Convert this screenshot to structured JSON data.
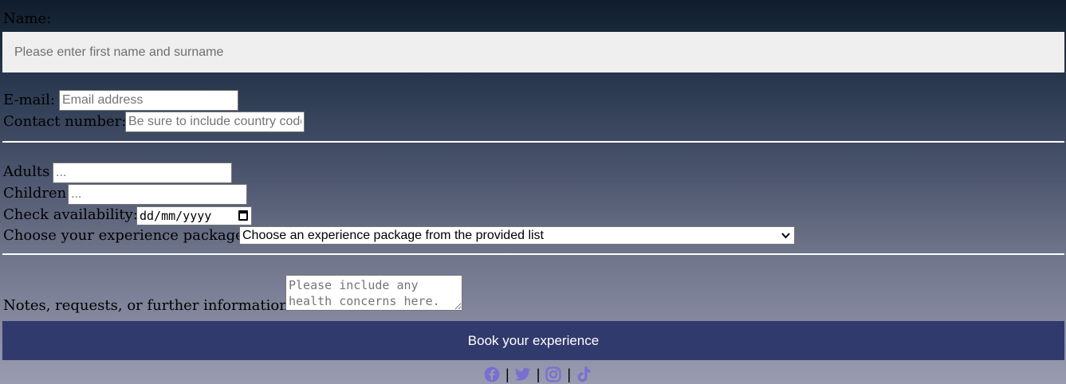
{
  "form": {
    "name": {
      "label": "Name:",
      "placeholder": "Please enter first name and surname"
    },
    "email": {
      "label": "E-mail:",
      "placeholder": "Email address"
    },
    "contact": {
      "label": "Contact number:",
      "placeholder": "Be sure to include country code"
    },
    "adults": {
      "label": "Adults",
      "placeholder": "..."
    },
    "children": {
      "label": "Children",
      "placeholder": "..."
    },
    "availability": {
      "label": "Check availability:",
      "value": "dd/mm/yyyy"
    },
    "package": {
      "label": "Choose your experience package:",
      "selected": "Choose an experience package from the provided list"
    },
    "notes": {
      "label": "Notes, requests, or further information:",
      "placeholder": "Please include any health concerns here."
    },
    "submit_label": "Book your experience"
  },
  "social": {
    "separator": "|",
    "icons": [
      "facebook-icon",
      "twitter-icon",
      "instagram-icon",
      "tiktok-icon"
    ],
    "icon_color": "#7a6fd0"
  }
}
